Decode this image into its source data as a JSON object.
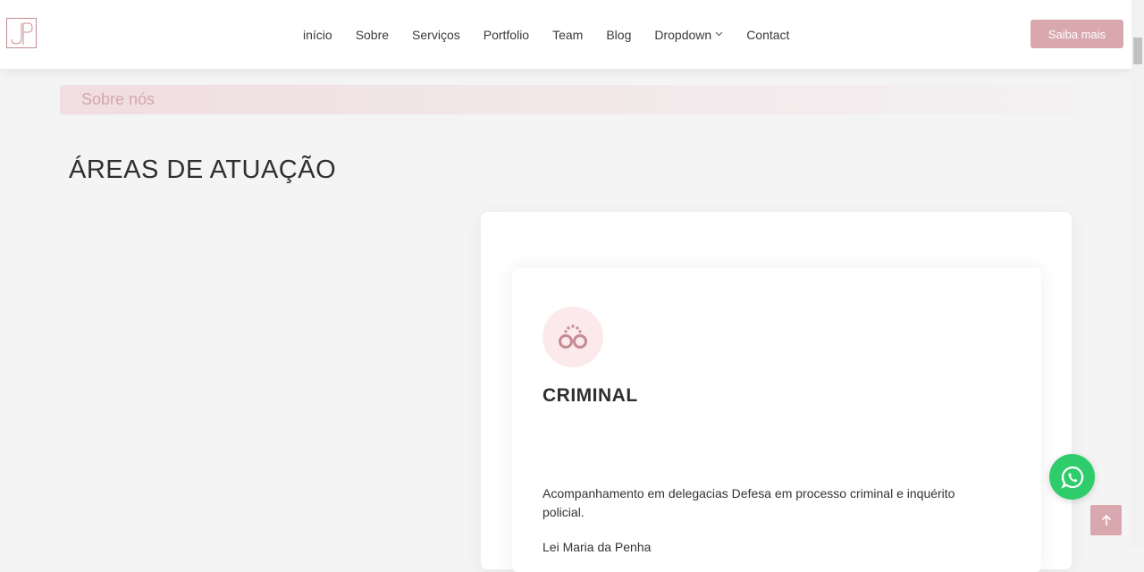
{
  "header": {
    "nav": [
      "início",
      "Sobre",
      "Serviços",
      "Portfolio",
      "Team",
      "Blog",
      "Dropdown",
      "Contact"
    ],
    "cta_label": "Saiba mais"
  },
  "breadcrumb": {
    "label": "Sobre nós"
  },
  "section": {
    "title": "ÁREAS DE ATUAÇÃO"
  },
  "card": {
    "icon": "handcuffs-icon",
    "title": "CRIMINAL",
    "text": "Acompanhamento em delegacias Defesa em processo criminal e inquérito policial.",
    "text2": "Lei Maria da Penha"
  },
  "floating": {
    "whatsapp_icon": "whatsapp-icon",
    "to_top_icon": "arrow-up-icon"
  },
  "colors": {
    "accent": "#d9a8ae",
    "accent_light": "#fbe9eb",
    "whatsapp": "#2fcc6b"
  }
}
